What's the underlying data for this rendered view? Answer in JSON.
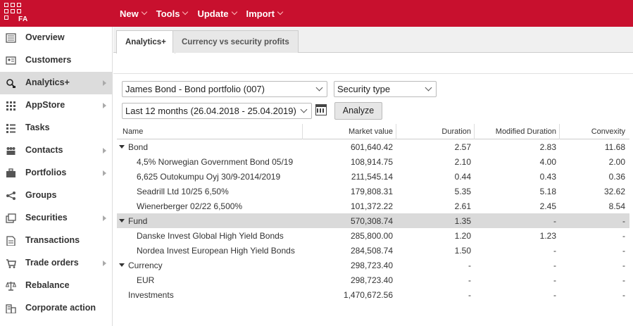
{
  "app": {
    "logo_text": "FA"
  },
  "topmenu": [
    {
      "label": "New"
    },
    {
      "label": "Tools"
    },
    {
      "label": "Update"
    },
    {
      "label": "Import"
    }
  ],
  "sidebar": {
    "items": [
      {
        "label": "Overview",
        "icon": "overview-icon",
        "has_arrow": false,
        "active": false
      },
      {
        "label": "Customers",
        "icon": "customers-icon",
        "has_arrow": false,
        "active": false
      },
      {
        "label": "Analytics+",
        "icon": "analytics-icon",
        "has_arrow": true,
        "active": true
      },
      {
        "label": "AppStore",
        "icon": "appstore-icon",
        "has_arrow": true,
        "active": false
      },
      {
        "label": "Tasks",
        "icon": "tasks-icon",
        "has_arrow": false,
        "active": false
      },
      {
        "label": "Contacts",
        "icon": "contacts-icon",
        "has_arrow": true,
        "active": false
      },
      {
        "label": "Portfolios",
        "icon": "portfolios-icon",
        "has_arrow": true,
        "active": false
      },
      {
        "label": "Groups",
        "icon": "groups-icon",
        "has_arrow": false,
        "active": false
      },
      {
        "label": "Securities",
        "icon": "securities-icon",
        "has_arrow": true,
        "active": false
      },
      {
        "label": "Transactions",
        "icon": "transactions-icon",
        "has_arrow": false,
        "active": false
      },
      {
        "label": "Trade orders",
        "icon": "trade-orders-icon",
        "has_arrow": true,
        "active": false
      },
      {
        "label": "Rebalance",
        "icon": "rebalance-icon",
        "has_arrow": false,
        "active": false
      },
      {
        "label": "Corporate action",
        "icon": "corporate-action-icon",
        "has_arrow": false,
        "active": false
      }
    ]
  },
  "tabs": [
    {
      "label": "Analytics+",
      "active": true
    },
    {
      "label": "Currency vs security profits",
      "active": false
    }
  ],
  "filters": {
    "portfolio": "James Bond - Bond portfolio (007)",
    "grouping": "Security type",
    "period": "Last 12 months (26.04.2018 - 25.04.2019)",
    "analyze_label": "Analyze"
  },
  "table": {
    "columns": [
      "Name",
      "Market value",
      "Duration",
      "Modified Duration",
      "Convexity"
    ],
    "rows": [
      {
        "name": "Bond",
        "level": 0,
        "expandable": true,
        "highlight": false,
        "market_value": "601,640.42",
        "duration": "2.57",
        "modified_duration": "2.83",
        "convexity": "11.68"
      },
      {
        "name": "4,5% Norwegian Government Bond 05/19",
        "level": 1,
        "expandable": false,
        "highlight": false,
        "market_value": "108,914.75",
        "duration": "2.10",
        "modified_duration": "4.00",
        "convexity": "2.00"
      },
      {
        "name": "6,625 Outokumpu Oyj 30/9-2014/2019",
        "level": 1,
        "expandable": false,
        "highlight": false,
        "market_value": "211,545.14",
        "duration": "0.44",
        "modified_duration": "0.43",
        "convexity": "0.36"
      },
      {
        "name": "Seadrill Ltd 10/25 6,50%",
        "level": 1,
        "expandable": false,
        "highlight": false,
        "market_value": "179,808.31",
        "duration": "5.35",
        "modified_duration": "5.18",
        "convexity": "32.62"
      },
      {
        "name": "Wienerberger 02/22 6,500%",
        "level": 1,
        "expandable": false,
        "highlight": false,
        "market_value": "101,372.22",
        "duration": "2.61",
        "modified_duration": "2.45",
        "convexity": "8.54"
      },
      {
        "name": "Fund",
        "level": 0,
        "expandable": true,
        "highlight": true,
        "market_value": "570,308.74",
        "duration": "1.35",
        "modified_duration": "-",
        "convexity": "-"
      },
      {
        "name": "Danske Invest Global High Yield Bonds",
        "level": 1,
        "expandable": false,
        "highlight": false,
        "market_value": "285,800.00",
        "duration": "1.20",
        "modified_duration": "1.23",
        "convexity": "-"
      },
      {
        "name": "Nordea Invest European High Yield Bonds",
        "level": 1,
        "expandable": false,
        "highlight": false,
        "market_value": "284,508.74",
        "duration": "1.50",
        "modified_duration": "-",
        "convexity": "-"
      },
      {
        "name": "Currency",
        "level": 0,
        "expandable": true,
        "highlight": false,
        "market_value": "298,723.40",
        "duration": "-",
        "modified_duration": "-",
        "convexity": "-"
      },
      {
        "name": "EUR",
        "level": 1,
        "expandable": false,
        "highlight": false,
        "market_value": "298,723.40",
        "duration": "-",
        "modified_duration": "-",
        "convexity": "-"
      },
      {
        "name": "Investments",
        "level": 0,
        "expandable": false,
        "highlight": false,
        "market_value": "1,470,672.56",
        "duration": "-",
        "modified_duration": "-",
        "convexity": "-"
      }
    ]
  },
  "colors": {
    "brand_red": "#c8102e",
    "active_bg": "#dcdcdc",
    "row_highlight": "#dadada"
  }
}
